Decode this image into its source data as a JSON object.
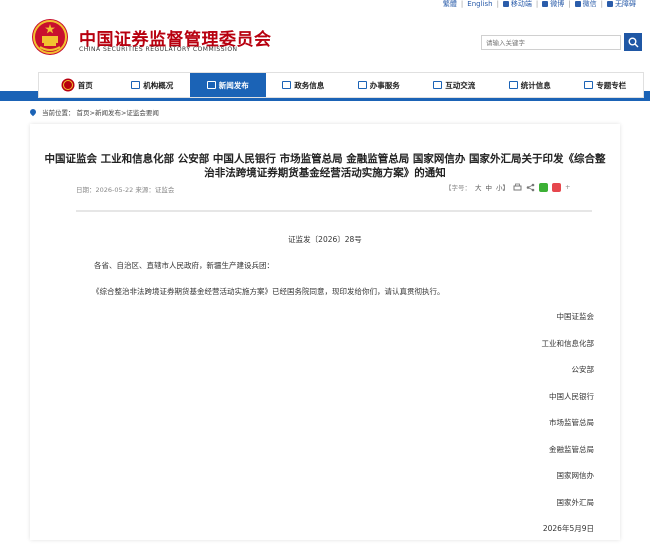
{
  "topbar": {
    "traditional": "繁體",
    "english": "English",
    "mobile": "移动端",
    "weibo": "微博",
    "wechat": "微信",
    "accessible": "无障碍"
  },
  "header": {
    "title_cn": "中国证券监督管理委员会",
    "title_en": "CHINA SECURITIES REGULATORY COMMISSION",
    "search_placeholder": "请输入关键字"
  },
  "nav": [
    {
      "label": "首页",
      "icon": "home-icon"
    },
    {
      "label": "机构概况",
      "icon": "building-icon"
    },
    {
      "label": "新闻发布",
      "icon": "news-icon",
      "active": true
    },
    {
      "label": "政务信息",
      "icon": "monitor-icon"
    },
    {
      "label": "办事服务",
      "icon": "service-icon"
    },
    {
      "label": "互动交流",
      "icon": "chat-icon"
    },
    {
      "label": "统计信息",
      "icon": "chart-icon"
    },
    {
      "label": "专题专栏",
      "icon": "doc-icon"
    }
  ],
  "breadcrumb": {
    "prefix": "当前位置：",
    "path": "首页>新闻发布>证监会要闻"
  },
  "article": {
    "title": "中国证监会 工业和信息化部 公安部 中国人民银行 市场监管总局 金融监管总局 国家网信办 国家外汇局关于印发《综合整治非法跨境证券期货基金经营活动实施方案》的通知",
    "meta": "日期：2026-05-22 来源：证监会",
    "font_label": "【字号：",
    "font_large": "大",
    "font_medium": "中",
    "font_small": "小】",
    "doc_number": "证监发〔2026〕28号",
    "salutation": "各省、自治区、直辖市人民政府，新疆生产建设兵团：",
    "body": "《综合整治非法跨境证券期货基金经营活动实施方案》已经国务院同意，现印发给你们，请认真贯彻执行。",
    "signatures": [
      "中国证监会",
      "工业和信息化部",
      "公安部",
      "中国人民银行",
      "市场监管总局",
      "金融监管总局",
      "国家网信办",
      "国家外汇局",
      "2026年5月9日"
    ]
  },
  "colors": {
    "brand_red": "#b8000f",
    "nav_blue": "#1b63b6",
    "link_blue": "#2a5caa"
  }
}
